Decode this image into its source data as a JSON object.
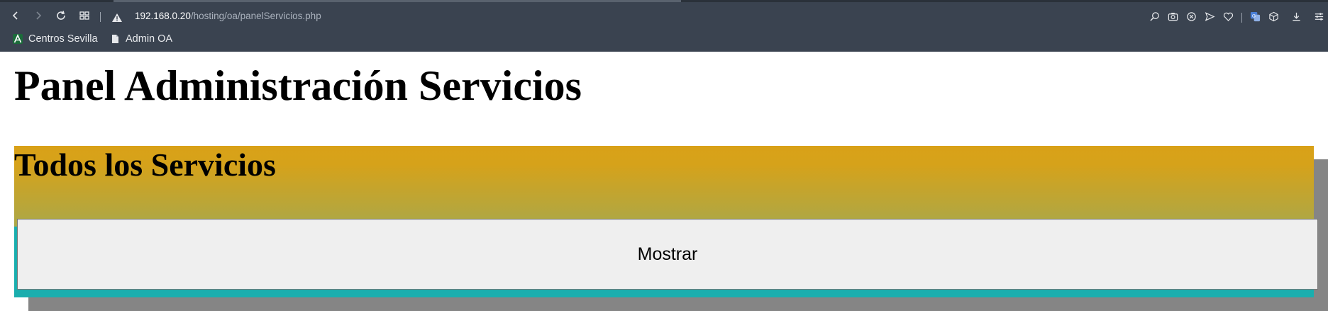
{
  "browser": {
    "url_host": "192.168.0.20",
    "url_path": "/hosting/oa/panelServicios.php",
    "bookmarks": [
      {
        "label": "Centros Sevilla",
        "icon": "centros-sevilla-favicon"
      },
      {
        "label": "Admin OA",
        "icon": "page-icon"
      }
    ],
    "colors": {
      "toolbar": "#3a4350",
      "text": "#e8eaed"
    }
  },
  "page": {
    "title": "Panel Administración Servicios",
    "section": {
      "title": "Todos los Servicios",
      "button_label": "Mostrar"
    },
    "colors": {
      "gradient_top": "#d9a118",
      "gradient_bottom": "#8eae5c",
      "teal": "#1aaeae",
      "shadow": "#858585",
      "button_bg": "#efefef"
    }
  }
}
